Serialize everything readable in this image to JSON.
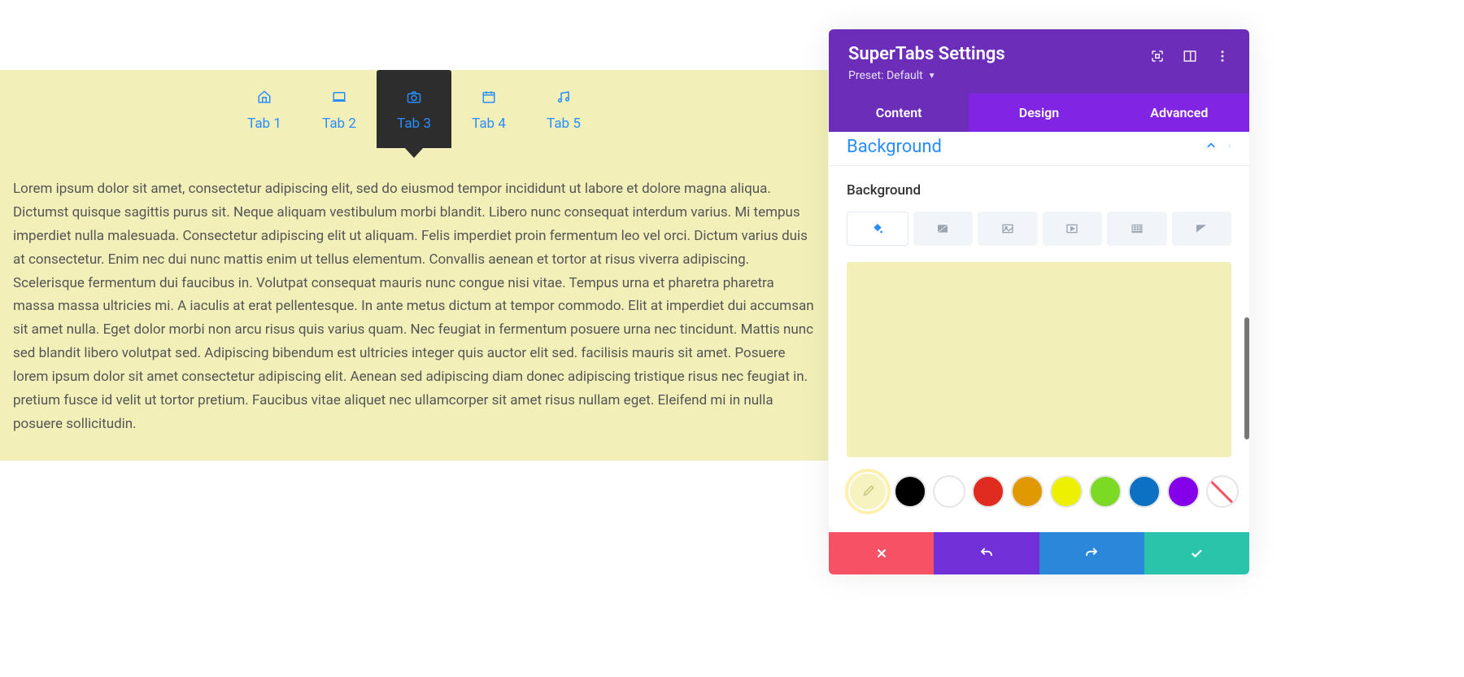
{
  "tabs": [
    {
      "label": "Tab 1",
      "iconName": "home-icon"
    },
    {
      "label": "Tab 2",
      "iconName": "laptop-icon"
    },
    {
      "label": "Tab 3",
      "iconName": "camera-icon",
      "active": true
    },
    {
      "label": "Tab 4",
      "iconName": "calendar-icon"
    },
    {
      "label": "Tab 5",
      "iconName": "music-icon"
    }
  ],
  "tab_content": "Lorem ipsum dolor sit amet, consectetur adipiscing elit, sed do eiusmod tempor incididunt ut labore et dolore magna aliqua. Dictumst quisque sagittis purus sit. Neque aliquam vestibulum morbi blandit. Libero nunc consequat interdum varius. Mi tempus imperdiet nulla malesuada. Consectetur adipiscing elit ut aliquam. Felis imperdiet proin fermentum leo vel orci. Dictum varius duis at consectetur. Enim nec dui nunc mattis enim ut tellus elementum. Convallis aenean et tortor at risus viverra adipiscing. Scelerisque fermentum dui faucibus in. Volutpat consequat mauris nunc congue nisi vitae. Tempus urna et pharetra pharetra massa massa ultricies mi. A iaculis at erat pellentesque. In ante metus dictum at tempor commodo. Elit at imperdiet dui accumsan sit amet nulla. Eget dolor morbi non arcu risus quis varius quam. Nec feugiat in fermentum posuere urna nec tincidunt. Mattis nunc sed blandit libero volutpat sed. Adipiscing bibendum est ultricies integer quis auctor elit sed. facilisis mauris sit amet. Posuere lorem ipsum dolor sit amet consectetur adipiscing elit. Aenean sed adipiscing diam donec adipiscing tristique risus nec feugiat in. pretium fusce id velit ut tortor pretium. Faucibus vitae aliquet nec ullamcorper sit amet risus nullam eget. Eleifend mi in nulla posuere sollicitudin.",
  "panel": {
    "title": "SuperTabs Settings",
    "preset": "Preset: Default",
    "tabs": {
      "content": "Content",
      "design": "Design",
      "advanced": "Advanced"
    },
    "section_title": "Background",
    "section_label": "Background",
    "current_color": "#f2f0b8",
    "swatches": [
      {
        "name": "eyedropper",
        "color": "#f6f3c0",
        "active": true,
        "eyedropper": true
      },
      {
        "name": "black",
        "color": "#000000"
      },
      {
        "name": "white",
        "color": "#ffffff"
      },
      {
        "name": "red",
        "color": "#e02b20"
      },
      {
        "name": "orange",
        "color": "#e09900"
      },
      {
        "name": "yellow",
        "color": "#edf000"
      },
      {
        "name": "green",
        "color": "#7cda24"
      },
      {
        "name": "blue",
        "color": "#0c71c3"
      },
      {
        "name": "purple",
        "color": "#8300e9"
      },
      {
        "name": "none",
        "color": "none"
      }
    ],
    "footer_colors": {
      "cancel": "#f65164",
      "undo": "#7231d8",
      "redo": "#2b87da",
      "save": "#29c4a9"
    }
  }
}
